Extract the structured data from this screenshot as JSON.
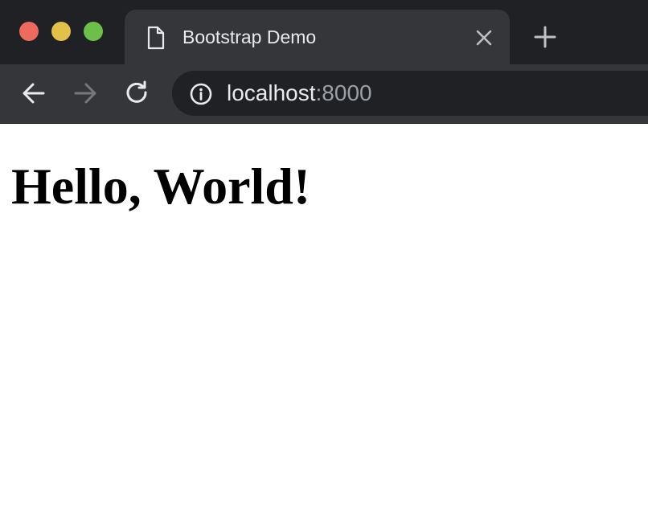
{
  "colors": {
    "tabstrip_background": "#202124",
    "active_tab_background": "#35363a",
    "toolbar_background": "#35363a",
    "omnibox_background": "#202124",
    "traffic_close": "#ed6a5e",
    "traffic_minimize": "#e2c04a",
    "traffic_maximize": "#6cc04a",
    "text_primary": "#e8eaed",
    "text_muted": "#9aa0a6",
    "page_background": "#ffffff",
    "heading_text": "#000000"
  },
  "window_controls": {
    "close_icon": "traffic-light-close",
    "minimize_icon": "traffic-light-minimize",
    "maximize_icon": "traffic-light-maximize"
  },
  "tab": {
    "title": "Bootstrap Demo",
    "page_icon": "document-icon",
    "close_icon": "close-icon"
  },
  "new_tab_icon": "plus-icon",
  "toolbar": {
    "back_icon": "arrow-left-icon",
    "forward_icon": "arrow-right-icon",
    "reload_icon": "reload-icon"
  },
  "address_bar": {
    "info_icon": "info-icon",
    "host": "localhost",
    "port": ":8000"
  },
  "page": {
    "heading": "Hello, World!"
  }
}
